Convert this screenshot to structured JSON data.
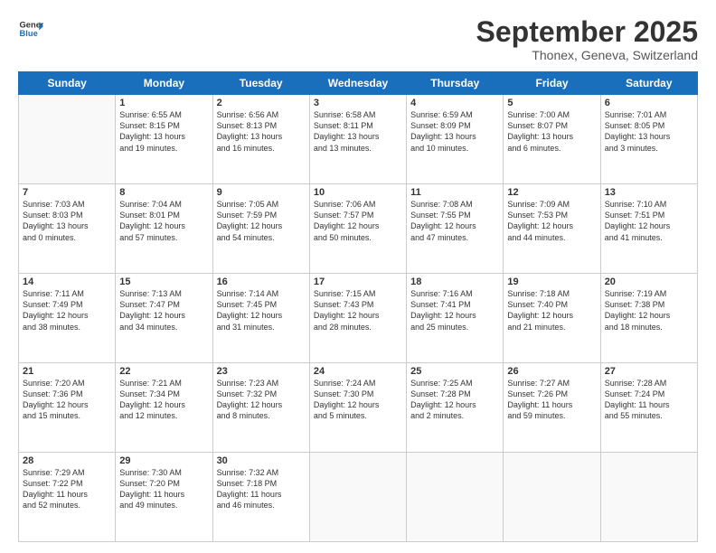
{
  "header": {
    "logo_line1": "General",
    "logo_line2": "Blue",
    "month": "September 2025",
    "location": "Thonex, Geneva, Switzerland"
  },
  "weekdays": [
    "Sunday",
    "Monday",
    "Tuesday",
    "Wednesday",
    "Thursday",
    "Friday",
    "Saturday"
  ],
  "weeks": [
    [
      {
        "day": "",
        "text": ""
      },
      {
        "day": "1",
        "text": "Sunrise: 6:55 AM\nSunset: 8:15 PM\nDaylight: 13 hours\nand 19 minutes."
      },
      {
        "day": "2",
        "text": "Sunrise: 6:56 AM\nSunset: 8:13 PM\nDaylight: 13 hours\nand 16 minutes."
      },
      {
        "day": "3",
        "text": "Sunrise: 6:58 AM\nSunset: 8:11 PM\nDaylight: 13 hours\nand 13 minutes."
      },
      {
        "day": "4",
        "text": "Sunrise: 6:59 AM\nSunset: 8:09 PM\nDaylight: 13 hours\nand 10 minutes."
      },
      {
        "day": "5",
        "text": "Sunrise: 7:00 AM\nSunset: 8:07 PM\nDaylight: 13 hours\nand 6 minutes."
      },
      {
        "day": "6",
        "text": "Sunrise: 7:01 AM\nSunset: 8:05 PM\nDaylight: 13 hours\nand 3 minutes."
      }
    ],
    [
      {
        "day": "7",
        "text": "Sunrise: 7:03 AM\nSunset: 8:03 PM\nDaylight: 13 hours\nand 0 minutes."
      },
      {
        "day": "8",
        "text": "Sunrise: 7:04 AM\nSunset: 8:01 PM\nDaylight: 12 hours\nand 57 minutes."
      },
      {
        "day": "9",
        "text": "Sunrise: 7:05 AM\nSunset: 7:59 PM\nDaylight: 12 hours\nand 54 minutes."
      },
      {
        "day": "10",
        "text": "Sunrise: 7:06 AM\nSunset: 7:57 PM\nDaylight: 12 hours\nand 50 minutes."
      },
      {
        "day": "11",
        "text": "Sunrise: 7:08 AM\nSunset: 7:55 PM\nDaylight: 12 hours\nand 47 minutes."
      },
      {
        "day": "12",
        "text": "Sunrise: 7:09 AM\nSunset: 7:53 PM\nDaylight: 12 hours\nand 44 minutes."
      },
      {
        "day": "13",
        "text": "Sunrise: 7:10 AM\nSunset: 7:51 PM\nDaylight: 12 hours\nand 41 minutes."
      }
    ],
    [
      {
        "day": "14",
        "text": "Sunrise: 7:11 AM\nSunset: 7:49 PM\nDaylight: 12 hours\nand 38 minutes."
      },
      {
        "day": "15",
        "text": "Sunrise: 7:13 AM\nSunset: 7:47 PM\nDaylight: 12 hours\nand 34 minutes."
      },
      {
        "day": "16",
        "text": "Sunrise: 7:14 AM\nSunset: 7:45 PM\nDaylight: 12 hours\nand 31 minutes."
      },
      {
        "day": "17",
        "text": "Sunrise: 7:15 AM\nSunset: 7:43 PM\nDaylight: 12 hours\nand 28 minutes."
      },
      {
        "day": "18",
        "text": "Sunrise: 7:16 AM\nSunset: 7:41 PM\nDaylight: 12 hours\nand 25 minutes."
      },
      {
        "day": "19",
        "text": "Sunrise: 7:18 AM\nSunset: 7:40 PM\nDaylight: 12 hours\nand 21 minutes."
      },
      {
        "day": "20",
        "text": "Sunrise: 7:19 AM\nSunset: 7:38 PM\nDaylight: 12 hours\nand 18 minutes."
      }
    ],
    [
      {
        "day": "21",
        "text": "Sunrise: 7:20 AM\nSunset: 7:36 PM\nDaylight: 12 hours\nand 15 minutes."
      },
      {
        "day": "22",
        "text": "Sunrise: 7:21 AM\nSunset: 7:34 PM\nDaylight: 12 hours\nand 12 minutes."
      },
      {
        "day": "23",
        "text": "Sunrise: 7:23 AM\nSunset: 7:32 PM\nDaylight: 12 hours\nand 8 minutes."
      },
      {
        "day": "24",
        "text": "Sunrise: 7:24 AM\nSunset: 7:30 PM\nDaylight: 12 hours\nand 5 minutes."
      },
      {
        "day": "25",
        "text": "Sunrise: 7:25 AM\nSunset: 7:28 PM\nDaylight: 12 hours\nand 2 minutes."
      },
      {
        "day": "26",
        "text": "Sunrise: 7:27 AM\nSunset: 7:26 PM\nDaylight: 11 hours\nand 59 minutes."
      },
      {
        "day": "27",
        "text": "Sunrise: 7:28 AM\nSunset: 7:24 PM\nDaylight: 11 hours\nand 55 minutes."
      }
    ],
    [
      {
        "day": "28",
        "text": "Sunrise: 7:29 AM\nSunset: 7:22 PM\nDaylight: 11 hours\nand 52 minutes."
      },
      {
        "day": "29",
        "text": "Sunrise: 7:30 AM\nSunset: 7:20 PM\nDaylight: 11 hours\nand 49 minutes."
      },
      {
        "day": "30",
        "text": "Sunrise: 7:32 AM\nSunset: 7:18 PM\nDaylight: 11 hours\nand 46 minutes."
      },
      {
        "day": "",
        "text": ""
      },
      {
        "day": "",
        "text": ""
      },
      {
        "day": "",
        "text": ""
      },
      {
        "day": "",
        "text": ""
      }
    ]
  ]
}
